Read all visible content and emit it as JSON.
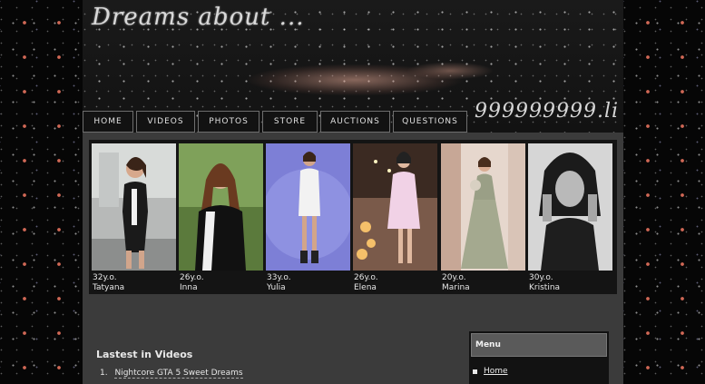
{
  "header": {
    "title": "Dreams about ...",
    "domain_suffix": "999999999.li"
  },
  "nav": [
    {
      "label": "Home"
    },
    {
      "label": "Videos"
    },
    {
      "label": "Photos"
    },
    {
      "label": "Store"
    },
    {
      "label": "Auctions"
    },
    {
      "label": "Questions"
    }
  ],
  "gallery": [
    {
      "age": "32y.o.",
      "name": "Tatyana"
    },
    {
      "age": "26y.o.",
      "name": "Inna"
    },
    {
      "age": "33y.o.",
      "name": "Yulia"
    },
    {
      "age": "26y.o.",
      "name": "Elena"
    },
    {
      "age": "20y.o.",
      "name": "Marina"
    },
    {
      "age": "30y.o.",
      "name": "Kristina"
    }
  ],
  "latest": {
    "title": "Lastest in Videos",
    "items": [
      {
        "num": "1.",
        "label": "Nightcore GTA 5 Sweet Dreams"
      }
    ]
  },
  "sidebar": {
    "title": "Menu",
    "items": [
      {
        "label": "Home"
      }
    ]
  },
  "colors": {
    "page_bg": "#3b3b3b",
    "gallery_bg": "#141414",
    "nav_bg": "#121212",
    "star_accent": "#dc6e5a"
  }
}
